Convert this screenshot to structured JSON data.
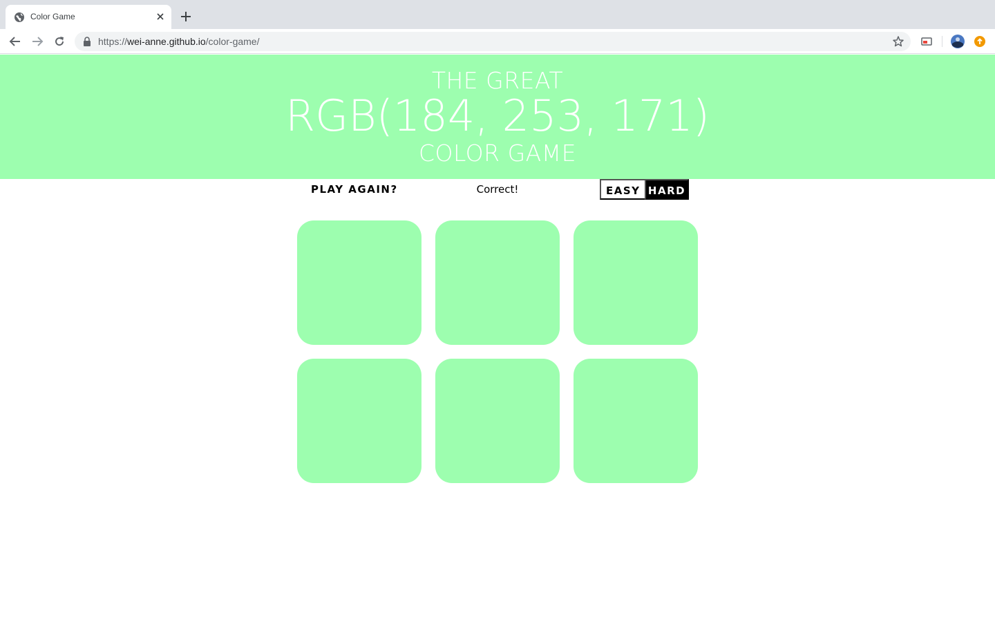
{
  "browser": {
    "tab_title": "Color Game",
    "url_scheme": "https://",
    "url_host": "wei-anne.github.io",
    "url_path": "/color-game/"
  },
  "header": {
    "line1": "THE GREAT",
    "rgb_display": "RGB(184, 253, 171)",
    "line3": "COLOR GAME",
    "background_color": "#9dfeaf"
  },
  "stripe": {
    "play_again_label": "PLAY AGAIN?",
    "message": "Correct!",
    "easy_label": "EASY",
    "hard_label": "HARD",
    "selected_mode": "HARD"
  },
  "squares": [
    {
      "color": "#9dfeaf"
    },
    {
      "color": "#9dfeaf"
    },
    {
      "color": "#9dfeaf"
    },
    {
      "color": "#9dfeaf"
    },
    {
      "color": "#9dfeaf"
    },
    {
      "color": "#9dfeaf"
    }
  ]
}
